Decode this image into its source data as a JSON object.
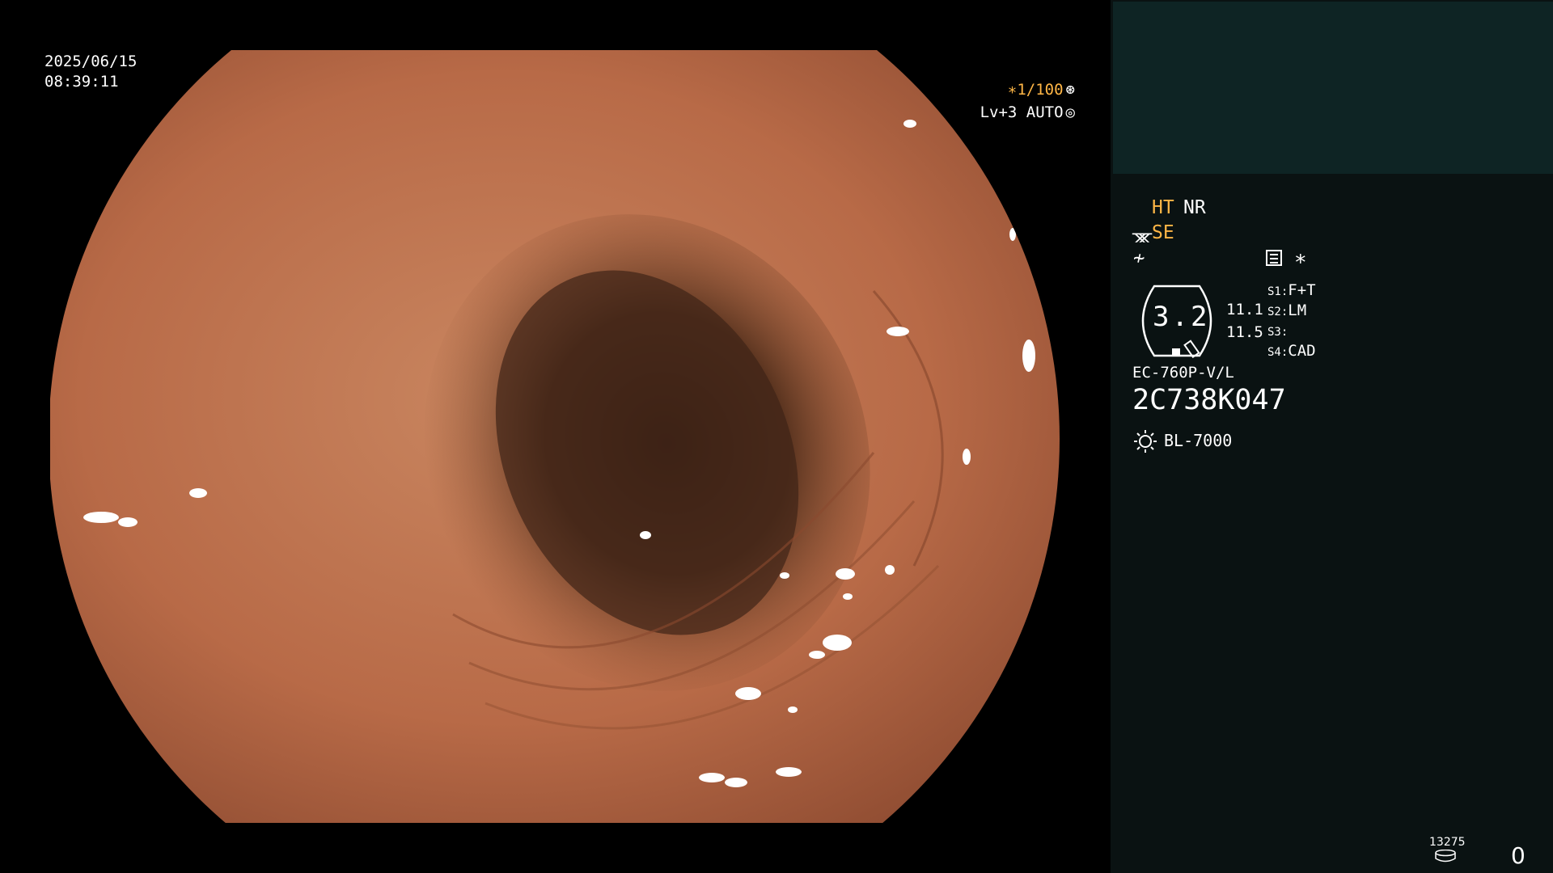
{
  "overlay": {
    "date": "2025/06/15",
    "time": "08:39:11",
    "shutter": "∗1/100",
    "level": "Lv+3 AUTO"
  },
  "panel": {
    "ht": "HT",
    "nr": "NR",
    "se": "SE",
    "star": "∗",
    "gauge_value": "3.2",
    "value_1": "11.1",
    "value_2": "11.5",
    "slots": [
      {
        "key": "S1:",
        "value": "F+T"
      },
      {
        "key": "S2:",
        "value": "LM"
      },
      {
        "key": "S3:",
        "value": ""
      },
      {
        "key": "S4:",
        "value": "CAD"
      }
    ],
    "scope_model": "EC-760P-V/L",
    "scope_serial": "2C738K047",
    "light_source": "BL-7000",
    "image_count": "13275",
    "counter": "0"
  },
  "colors": {
    "accent_orange": "#ffb646",
    "panel_bg": "#0a1212",
    "thumb_bg": "#0e2424",
    "tissue": "#b86a47"
  },
  "icons": [
    "aperture-icon",
    "iris-icon",
    "scope-tip-icon",
    "signal-icon",
    "document-icon",
    "gauge-icon",
    "sun-icon",
    "database-icon"
  ]
}
